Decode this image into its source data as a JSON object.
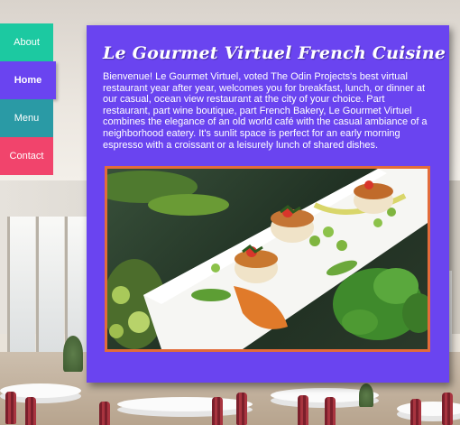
{
  "nav": {
    "items": [
      {
        "label": "About"
      },
      {
        "label": "Home"
      },
      {
        "label": "Menu"
      },
      {
        "label": "Contact"
      }
    ],
    "active": "Home"
  },
  "main": {
    "title": "Le Gourmet Virtuel French Cuisine",
    "description": "Bienvenue! Le Gourmet Virtuel, voted The Odin Projects's best virtual restaurant year after year, welcomes you for breakfast, lunch, or dinner at our casual, ocean view restaurant at the city of your choice. Part restaurant, part wine boutique, part French Bakery, Le Gourmet Virtuel combines the elegance of an old world café with the casual ambiance of a neighborhood eatery. It's sunlit space is perfect for an early morning espresso with a croissant or a leisurely lunch of shared dishes."
  },
  "colors": {
    "card": "#6a44f0",
    "about": "#1cc9a1",
    "home": "#6a44f0",
    "menu": "#2a9aa5",
    "contact": "#f1446c",
    "photo_border": "#e26c3b"
  }
}
